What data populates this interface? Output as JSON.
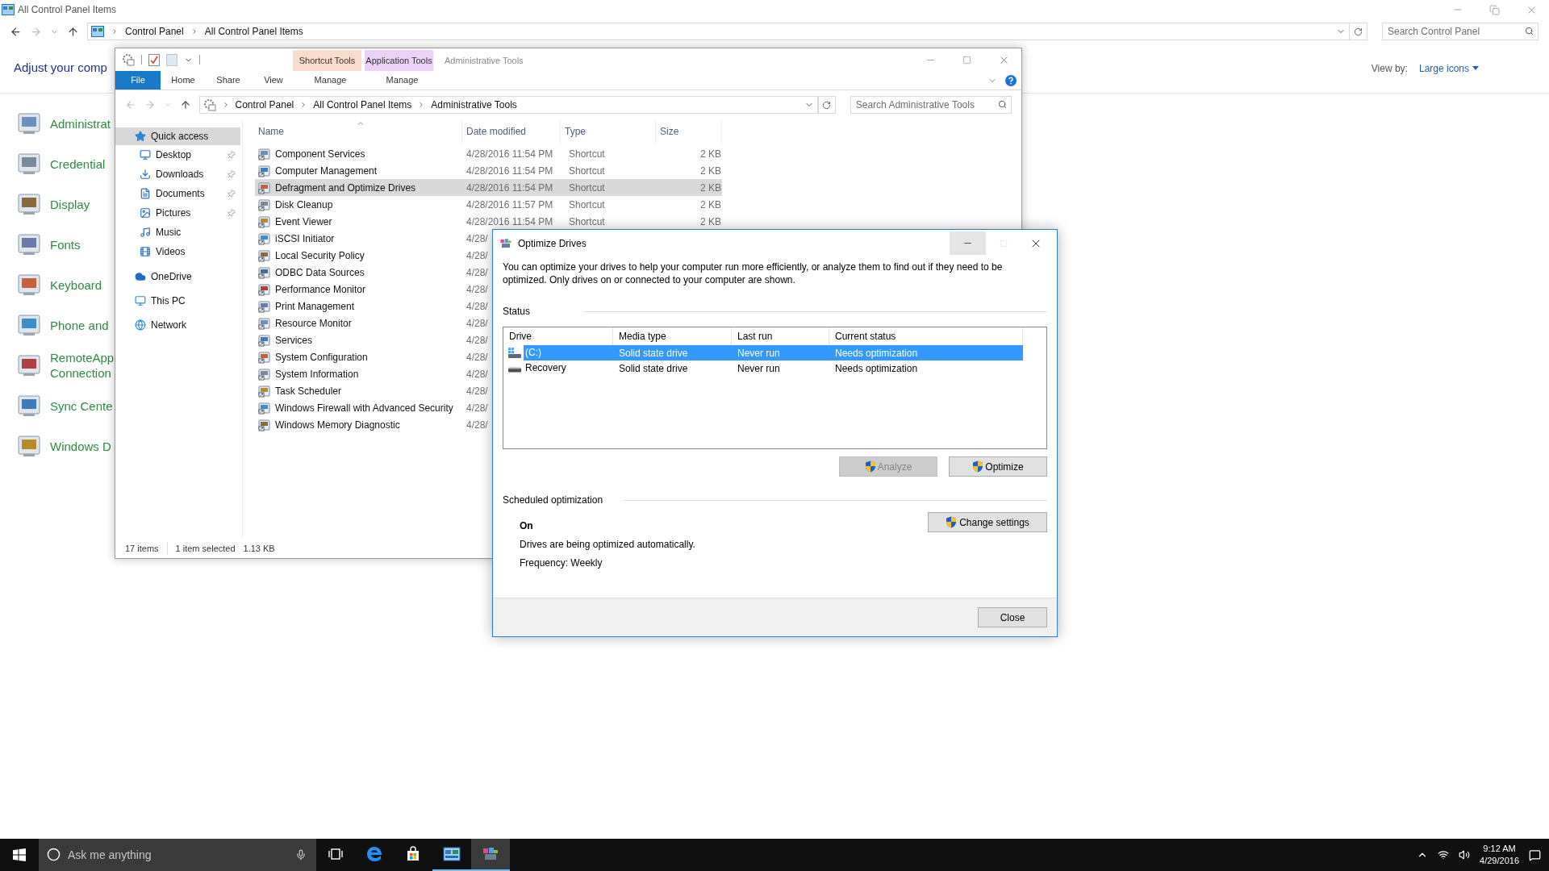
{
  "background_window": {
    "title": "All Control Panel Items",
    "breadcrumb": [
      "Control Panel",
      "All Control Panel Items"
    ],
    "search": {
      "placeholder": "Search Control Panel"
    },
    "heading": "Adjust your comp",
    "view_by": {
      "label": "View by:",
      "value": "Large icons"
    },
    "items": [
      {
        "label": "Administrat"
      },
      {
        "label": "Credential"
      },
      {
        "label": "Display"
      },
      {
        "label": "Fonts"
      },
      {
        "label": "Keyboard"
      },
      {
        "label": "Phone and"
      },
      {
        "label": "RemoteApp Connection"
      },
      {
        "label": "Sync Cente"
      },
      {
        "label": "Windows D"
      }
    ]
  },
  "explorer": {
    "title": "Administrative Tools",
    "file_tab": "File",
    "tabs": [
      {
        "label": "Home"
      },
      {
        "label": "Share"
      },
      {
        "label": "View"
      }
    ],
    "contextual_tab_groups": [
      {
        "group": "Shortcut Tools",
        "tab": "Manage",
        "color": "#fcdccc"
      },
      {
        "group": "Application Tools",
        "tab": "Manage",
        "color": "#ecd2f8"
      }
    ],
    "breadcrumb": [
      "Control Panel",
      "All Control Panel Items",
      "Administrative Tools"
    ],
    "search": {
      "placeholder": "Search Administrative Tools"
    },
    "nav": [
      {
        "label": "Quick access",
        "selected": true,
        "children": [
          {
            "label": "Desktop",
            "pinned": true
          },
          {
            "label": "Downloads",
            "pinned": true
          },
          {
            "label": "Documents",
            "pinned": true
          },
          {
            "label": "Pictures",
            "pinned": true
          },
          {
            "label": "Music",
            "pinned": false
          },
          {
            "label": "Videos",
            "pinned": false
          }
        ]
      },
      {
        "label": "OneDrive",
        "selected": false
      },
      {
        "label": "This PC",
        "selected": false
      },
      {
        "label": "Network",
        "selected": false
      }
    ],
    "columns": [
      "Name",
      "Date modified",
      "Type",
      "Size"
    ],
    "rows": [
      {
        "name": "Component Services",
        "date": "4/28/2016 11:54 PM",
        "type": "Shortcut",
        "size": "2 KB",
        "selected": false
      },
      {
        "name": "Computer Management",
        "date": "4/28/2016 11:54 PM",
        "type": "Shortcut",
        "size": "2 KB",
        "selected": false
      },
      {
        "name": "Defragment and Optimize Drives",
        "date": "4/28/2016 11:54 PM",
        "type": "Shortcut",
        "size": "2 KB",
        "selected": true
      },
      {
        "name": "Disk Cleanup",
        "date": "4/28/2016 11:57 PM",
        "type": "Shortcut",
        "size": "2 KB",
        "selected": false
      },
      {
        "name": "Event Viewer",
        "date": "4/28/2016 11:54 PM",
        "type": "Shortcut",
        "size": "2 KB",
        "selected": false
      },
      {
        "name": "iSCSI Initiator",
        "date": "4/28/",
        "selected": false
      },
      {
        "name": "Local Security Policy",
        "date": "4/28/",
        "selected": false
      },
      {
        "name": "ODBC Data Sources",
        "date": "4/28/",
        "selected": false
      },
      {
        "name": "Performance Monitor",
        "date": "4/28/",
        "selected": false
      },
      {
        "name": "Print Management",
        "date": "4/28/",
        "selected": false
      },
      {
        "name": "Resource Monitor",
        "date": "4/28/",
        "selected": false
      },
      {
        "name": "Services",
        "date": "4/28/",
        "selected": false
      },
      {
        "name": "System Configuration",
        "date": "4/28/",
        "selected": false
      },
      {
        "name": "System Information",
        "date": "4/28/",
        "selected": false
      },
      {
        "name": "Task Scheduler",
        "date": "4/28/",
        "selected": false
      },
      {
        "name": "Windows Firewall with Advanced Security",
        "date": "4/28/",
        "selected": false
      },
      {
        "name": "Windows Memory Diagnostic",
        "date": "4/28/",
        "selected": false
      }
    ],
    "status_bar": {
      "count": "17 items",
      "selection": "1 item selected",
      "size": "1.13 KB"
    }
  },
  "dialog": {
    "title": "Optimize Drives",
    "description": "You can optimize your drives to help your computer run more efficiently, or analyze them to find out if they need to be optimized. Only drives on or connected to your computer are shown.",
    "status_label": "Status",
    "columns": [
      "Drive",
      "Media type",
      "Last run",
      "Current status"
    ],
    "drives": [
      {
        "drive": "(C:)",
        "media_type": "Solid state drive",
        "last_run": "Never run",
        "current_status": "Needs optimization",
        "selected": true,
        "kind": "system"
      },
      {
        "drive": "Recovery",
        "media_type": "Solid state drive",
        "last_run": "Never run",
        "current_status": "Needs optimization",
        "selected": false,
        "kind": "plain"
      }
    ],
    "buttons": [
      {
        "label": "Analyze",
        "disabled": true
      },
      {
        "label": "Optimize",
        "disabled": false
      }
    ],
    "scheduled": {
      "label": "Scheduled optimization",
      "state": "On",
      "description": "Drives are being optimized automatically.",
      "frequency": "Frequency: Weekly",
      "button": "Change settings"
    },
    "close_button": "Close"
  },
  "taskbar": {
    "search": {
      "placeholder": "Ask me anything"
    },
    "apps": [
      {
        "kind": "task-view",
        "running": false,
        "selected": false
      },
      {
        "kind": "edge",
        "running": false,
        "selected": false
      },
      {
        "kind": "store",
        "running": false,
        "selected": false
      },
      {
        "kind": "control-panel",
        "running": true,
        "selected": false
      },
      {
        "kind": "defrag",
        "running": true,
        "selected": true
      }
    ],
    "clock": {
      "time": "9:12 AM",
      "date": "4/29/2016"
    }
  }
}
